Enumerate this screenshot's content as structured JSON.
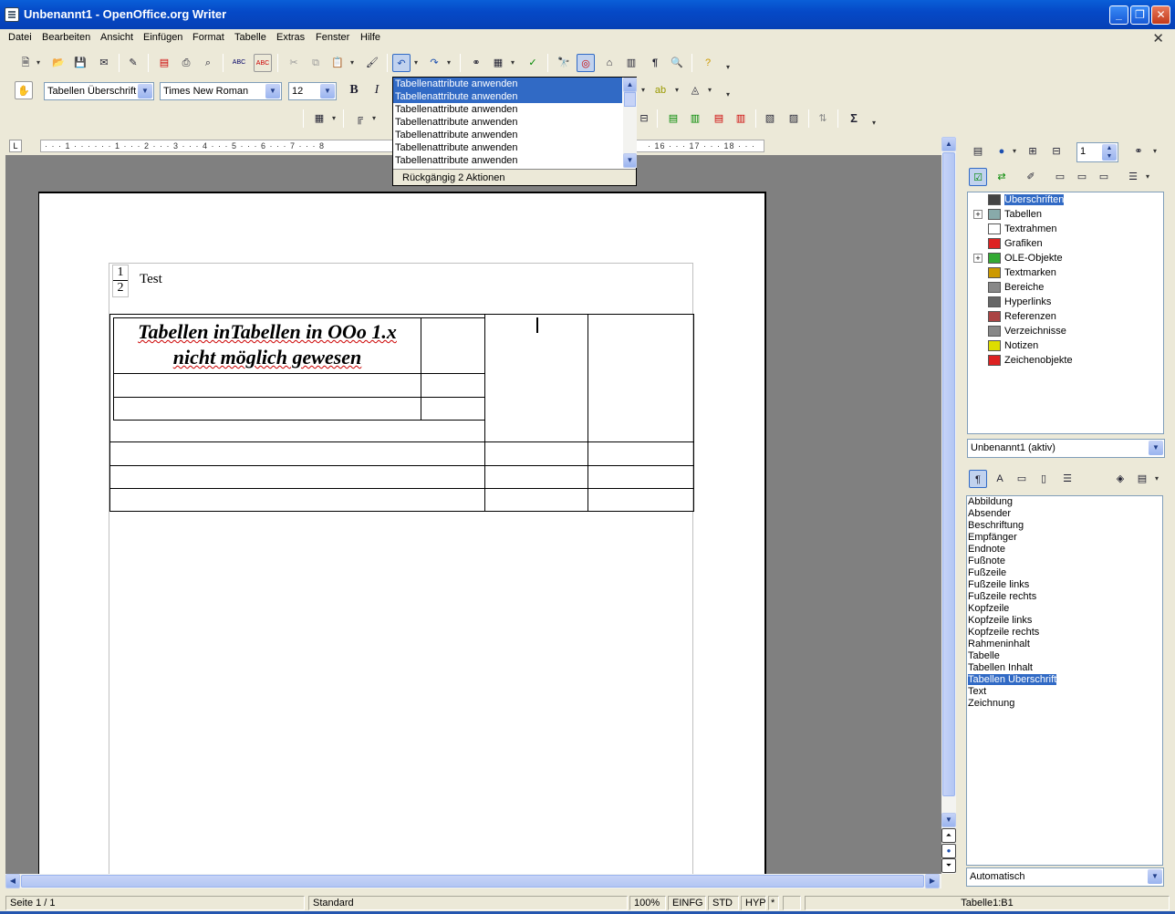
{
  "window": {
    "title": "Unbenannt1 - OpenOffice.org Writer"
  },
  "menu": [
    "Datei",
    "Bearbeiten",
    "Ansicht",
    "Einfügen",
    "Format",
    "Tabelle",
    "Extras",
    "Fenster",
    "Hilfe"
  ],
  "formatting": {
    "paragraph_style": "Tabellen Überschrift",
    "font_name": "Times New Roman",
    "font_size": "12",
    "bold": "B",
    "italic": "I"
  },
  "toolbar_misc": {
    "pilcrow": "¶",
    "sigma": "Σ"
  },
  "undo_dropdown": {
    "items": [
      "Tabellenattribute anwenden",
      "Tabellenattribute anwenden",
      "Tabellenattribute anwenden",
      "Tabellenattribute anwenden",
      "Tabellenattribute anwenden",
      "Tabellenattribute anwenden",
      "Tabellenattribute anwenden"
    ],
    "selected_count": 2,
    "footer": "Rückgängig 2 Aktionen"
  },
  "ruler": {
    "text": "· · · 1 · · ·   · · · 1 · · · 2 · · · 3 · · · 4 · · · 5 · · · 6 · · · 7 · · · 8"
  },
  "ruler_right": {
    "text": "· 16 · · · 17 · · · 18 · · ·"
  },
  "document": {
    "frame_fraction_num": "1",
    "frame_fraction_den": "2",
    "frame_text": "Test",
    "heading_line1": "Tabellen inTabellen in OOo 1.x",
    "heading_line2": "nicht möglich gewesen"
  },
  "navigator": {
    "page_value": "1",
    "tree": [
      {
        "label": "Überschriften",
        "expand": false,
        "selected": true,
        "icon": "headings-icon"
      },
      {
        "label": "Tabellen",
        "expand": true,
        "selected": false,
        "icon": "table-icon"
      },
      {
        "label": "Textrahmen",
        "expand": false,
        "selected": false,
        "icon": "text-frame-icon"
      },
      {
        "label": "Grafiken",
        "expand": false,
        "selected": false,
        "icon": "graphics-icon"
      },
      {
        "label": "OLE-Objekte",
        "expand": true,
        "selected": false,
        "icon": "ole-object-icon"
      },
      {
        "label": "Textmarken",
        "expand": false,
        "selected": false,
        "icon": "bookmark-icon"
      },
      {
        "label": "Bereiche",
        "expand": false,
        "selected": false,
        "icon": "sections-icon"
      },
      {
        "label": "Hyperlinks",
        "expand": false,
        "selected": false,
        "icon": "hyperlink-icon"
      },
      {
        "label": "Referenzen",
        "expand": false,
        "selected": false,
        "icon": "references-icon"
      },
      {
        "label": "Verzeichnisse",
        "expand": false,
        "selected": false,
        "icon": "indexes-icon"
      },
      {
        "label": "Notizen",
        "expand": false,
        "selected": false,
        "icon": "notes-icon"
      },
      {
        "label": "Zeichenobjekte",
        "expand": false,
        "selected": false,
        "icon": "drawing-objects-icon"
      }
    ],
    "document_select": "Unbenannt1 (aktiv)"
  },
  "styles": {
    "items": [
      "Abbildung",
      "Absender",
      "Beschriftung",
      "Empfänger",
      "Endnote",
      "Fußnote",
      "Fußzeile",
      "Fußzeile links",
      "Fußzeile rechts",
      "Kopfzeile",
      "Kopfzeile links",
      "Kopfzeile rechts",
      "Rahmeninhalt",
      "Tabelle",
      "Tabellen Inhalt",
      "Tabellen Überschrift",
      "Text",
      "Zeichnung"
    ],
    "selected": "Tabellen Überschrift",
    "filter": "Automatisch"
  },
  "statusbar": {
    "page": "Seite 1 / 1",
    "page_style": "Standard",
    "zoom": "100%",
    "insert_mode": "EINFG",
    "selection_mode": "STD",
    "hyperlink_mode": "HYP",
    "modified": "*",
    "cell": "Tabelle1:B1"
  }
}
